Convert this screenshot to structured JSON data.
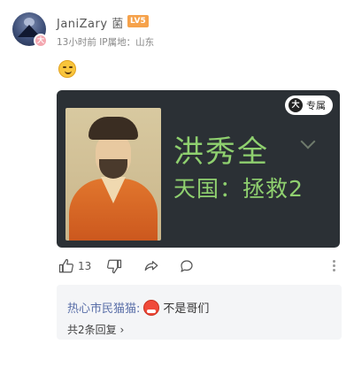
{
  "post": {
    "username": "JaniZary",
    "username_extra": "菌",
    "level": "LV5",
    "avatar_badge": "大",
    "meta": "13小时前 IP属地：山东"
  },
  "card": {
    "exclusive_icon": "大",
    "exclusive_label": "专属",
    "game_title": "洪秀全",
    "game_subtitle": "天国：拯救2"
  },
  "actions": {
    "like_count": "13",
    "icons": [
      "thumbs-up-icon",
      "thumbs-down-icon",
      "share-icon",
      "comment-icon",
      "more-icon"
    ]
  },
  "replies": {
    "user": "热心市民猫猫:",
    "text": "不是哥们",
    "more": "共2条回复",
    "more_chevron": "›"
  }
}
